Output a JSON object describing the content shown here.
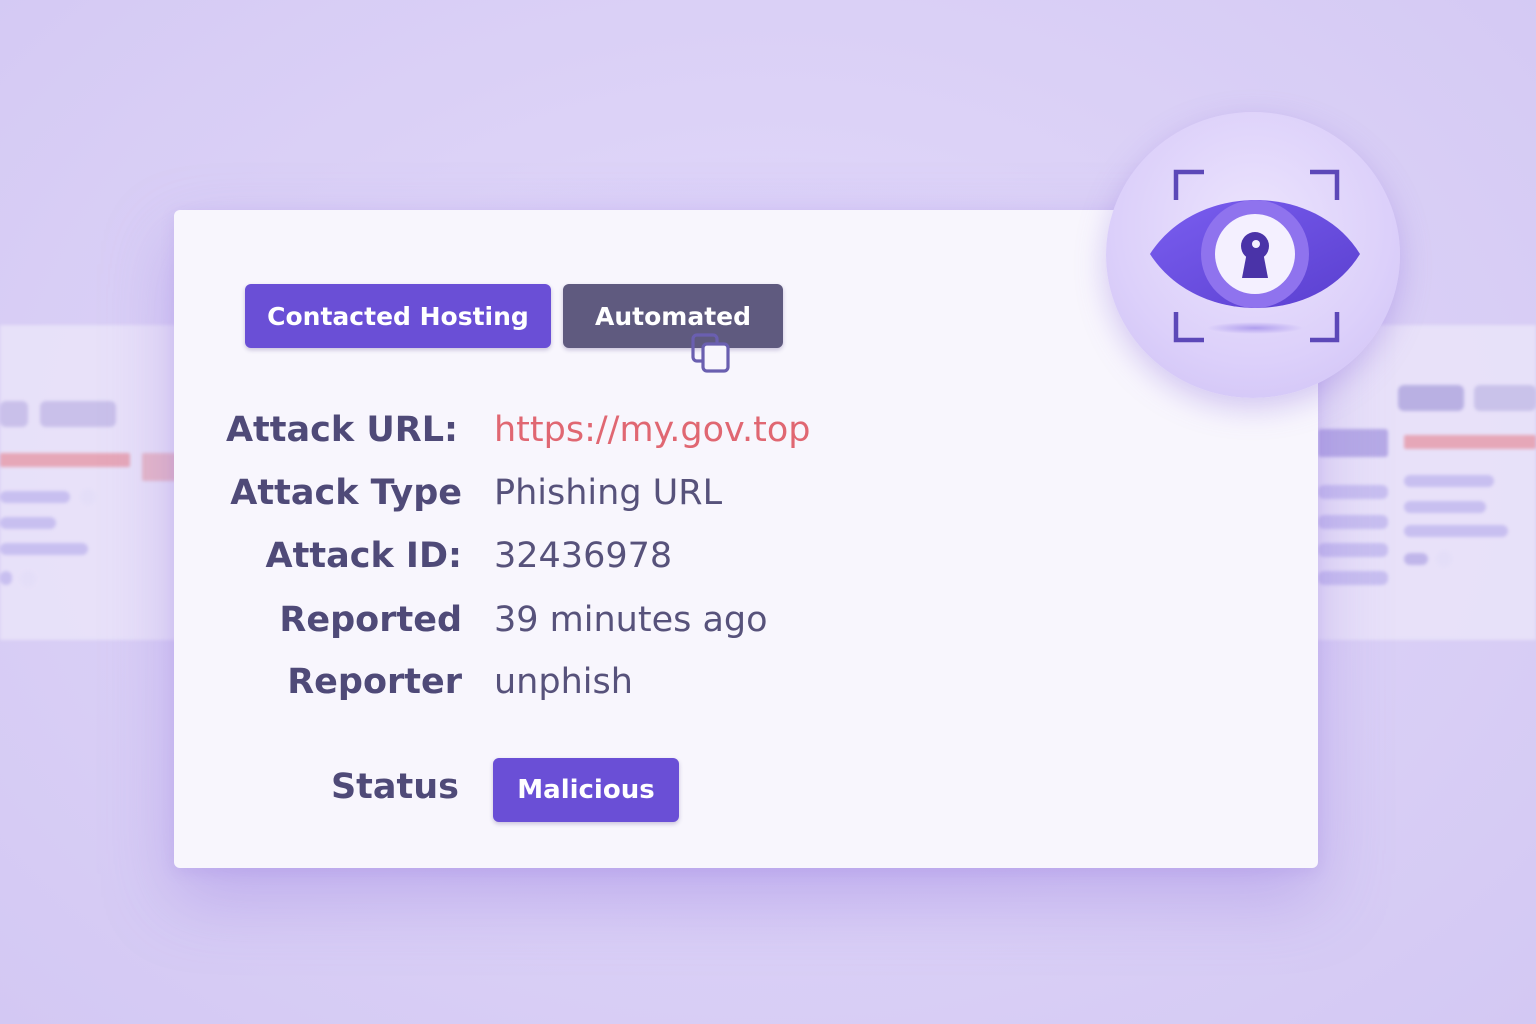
{
  "tags": {
    "hosting_label": "Contacted Hosting",
    "automated_label": "Automated"
  },
  "details": {
    "attack_url_label": "Attack URL:",
    "attack_url_value": "https://my.gov.top",
    "attack_type_label": "Attack Type",
    "attack_type_value": "Phishing URL",
    "attack_id_label": "Attack ID:",
    "attack_id_value": "32436978",
    "reported_label": "Reported",
    "reported_value": "39 minutes ago",
    "reporter_label": "Reporter",
    "reporter_value": "unphish",
    "status_label": "Status",
    "status_value": "Malicious"
  },
  "icons": {
    "copy": "copy-icon",
    "badge": "eye-keyhole-icon"
  },
  "colors": {
    "accent": "#6a4fd6",
    "neutral_tag": "#5f5a7f",
    "url": "#e06772",
    "label_text": "#4f4a78"
  }
}
